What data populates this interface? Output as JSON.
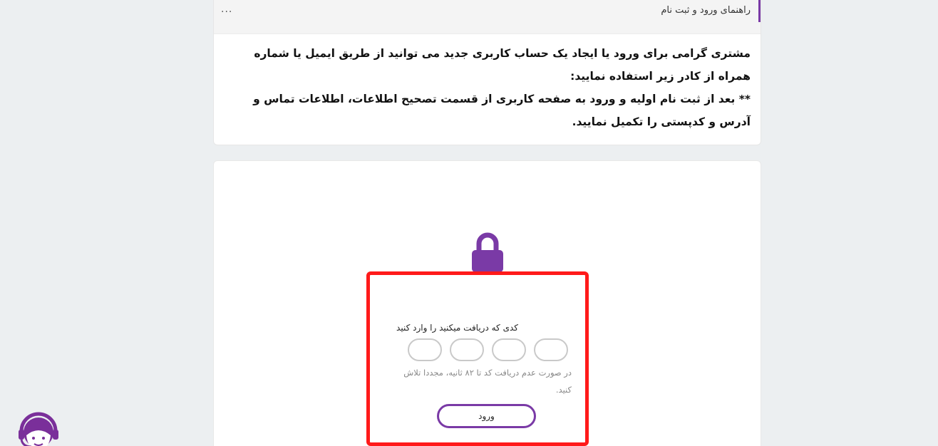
{
  "guide": {
    "title": "راهنمای ورود و ثبت نام",
    "more": "...",
    "line1": "مشتری گرامی برای ورود یا ایجاد یک حساب کاربری جدید می توانید از طریق ایمیل یا شماره همراه از کادر زیر استفاده نمایید:",
    "line2": "** بعد از ثبت نام اولیه و ورود به صفحه کاربری از قسمت تصحیح اطلاعات، اطلاعات تماس و آدرس و کدپستی را تکمیل نمایید."
  },
  "login": {
    "otp_label": "کدی که دریافت میکنید را وارد کنید",
    "otp_digits": [
      "",
      "",
      "",
      ""
    ],
    "resend_text": "در صورت عدم دریافت کد تا ۸۲ ثانیه، مجددا تلاش کنید.",
    "submit_label": "ورود"
  },
  "icons": {
    "lock": "lock-icon",
    "support": "support-agent-icon"
  },
  "colors": {
    "accent": "#7a3aa6",
    "highlight": "#ff1a1a"
  }
}
